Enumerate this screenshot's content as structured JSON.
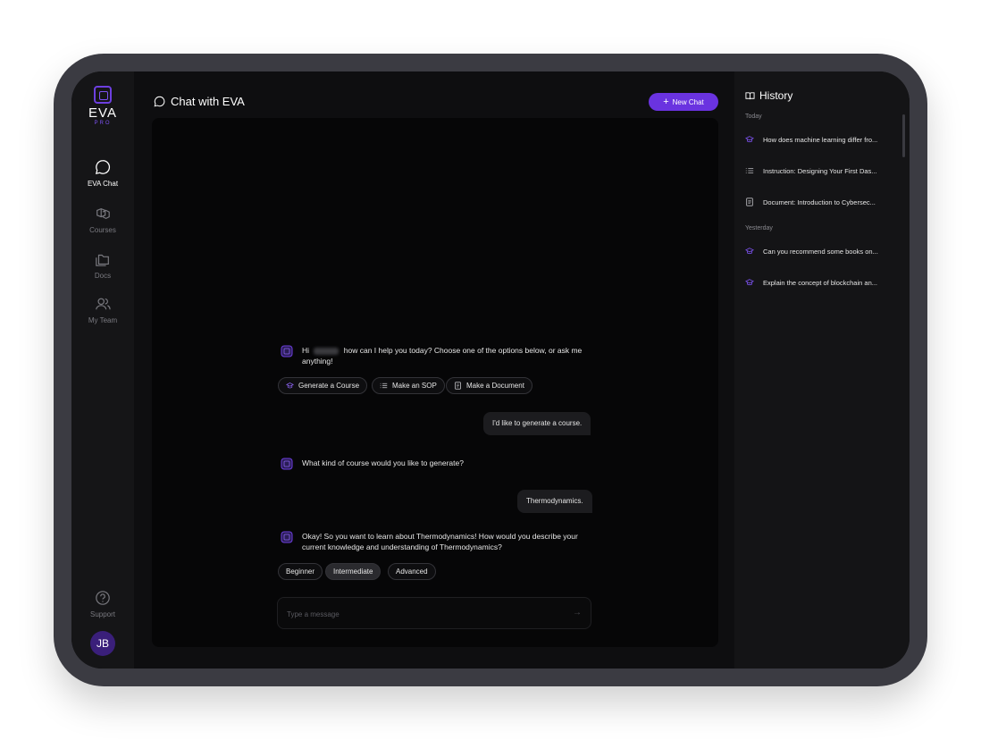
{
  "brand": {
    "name": "EVA",
    "sub": "PRO"
  },
  "nav": {
    "items": [
      {
        "label": "EVA Chat",
        "icon": "chat-bubble-icon",
        "active": true
      },
      {
        "label": "Courses",
        "icon": "cubes-icon"
      },
      {
        "label": "Docs",
        "icon": "folder-icon"
      },
      {
        "label": "My Team",
        "icon": "users-icon"
      }
    ],
    "support": "Support",
    "avatar": "JB"
  },
  "header": {
    "title": "Chat with EVA",
    "new_chat": "New Chat"
  },
  "chat": {
    "greeting_hi": "Hi",
    "greeting_rest": "how can I help you today? Choose one of the options below, or ask me anything!",
    "options": [
      "Generate a Course",
      "Make an SOP",
      "Make a Document"
    ],
    "user1": "I'd like to generate a course.",
    "bot2": "What kind of course would you like to generate?",
    "user2": "Thermodynamics.",
    "bot3": "Okay! So you want to learn about Thermodynamics! How would you describe your current knowledge and understanding of Thermodynamics?",
    "levels": [
      "Beginner",
      "Intermediate",
      "Advanced"
    ],
    "input_placeholder": "Type a message"
  },
  "history": {
    "title": "History",
    "sections": [
      {
        "label": "Today",
        "items": [
          {
            "text": "How does machine learning differ fro...",
            "icon": "graduation-cap-icon"
          },
          {
            "text": "Instruction: Designing Your First Das...",
            "icon": "list-icon"
          },
          {
            "text": "Document: Introduction to Cybersec...",
            "icon": "document-icon"
          }
        ]
      },
      {
        "label": "Yesterday",
        "items": [
          {
            "text": "Can you recommend some books on...",
            "icon": "graduation-cap-icon"
          },
          {
            "text": "Explain the concept of blockchain an...",
            "icon": "graduation-cap-icon"
          }
        ]
      }
    ]
  },
  "colors": {
    "accent": "#6a33e0",
    "bg": "#0e0e10",
    "panel": "#060607"
  }
}
